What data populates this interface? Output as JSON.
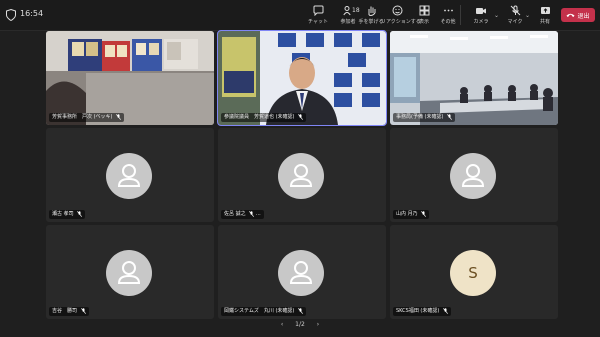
{
  "header": {
    "time": "16:54",
    "participant_count": "18",
    "tools": [
      {
        "id": "chat",
        "label": "チャット"
      },
      {
        "id": "people",
        "label": "参加者"
      },
      {
        "id": "hand",
        "label": "手を挙げる"
      },
      {
        "id": "react",
        "label": "リアクションする"
      },
      {
        "id": "view",
        "label": "表示"
      },
      {
        "id": "more",
        "label": "その他"
      },
      {
        "id": "camera",
        "label": "カメラ"
      },
      {
        "id": "mic",
        "label": "マイク"
      },
      {
        "id": "share",
        "label": "共有"
      }
    ],
    "leave_label": "退出"
  },
  "tiles": [
    {
      "name": "芳賀事務所　戸次 (ベッキ)",
      "type": "video"
    },
    {
      "name": "参議院議員　芳賀道也 (未確認)",
      "type": "video"
    },
    {
      "name": "事務局(予備 (未確認)",
      "type": "video"
    },
    {
      "name": "瀬古 孝司",
      "type": "avatar"
    },
    {
      "name": "佐呂 誠之",
      "type": "avatar",
      "extra": "…"
    },
    {
      "name": "山内 月乃",
      "type": "avatar"
    },
    {
      "name": "吉谷　勝司",
      "type": "avatar"
    },
    {
      "name": "岡鐵システムズ　丸川 (未確認)",
      "type": "avatar"
    },
    {
      "name": "SKCS福田 (未確認)",
      "type": "initial",
      "initial": "S"
    }
  ],
  "pager": {
    "text": "1/2"
  },
  "colors": {
    "leave": "#c4314b",
    "active_border": "#7f85f5",
    "tile_bg": "#292929"
  }
}
